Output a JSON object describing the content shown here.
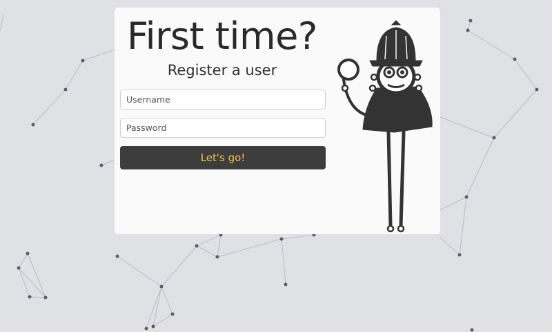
{
  "register": {
    "title": "First time?",
    "subtitle": "Register a user",
    "username_placeholder": "Username",
    "password_placeholder": "Password",
    "submit_label": "Let's go!"
  },
  "colors": {
    "background": "#dfe1e5",
    "card": "#fafafa",
    "button": "#3d3d3d",
    "button_text": "#f2c14e",
    "mascot": "#333333"
  },
  "icons": [
    "detective-mascot-icon",
    "magnifying-glass-icon"
  ]
}
